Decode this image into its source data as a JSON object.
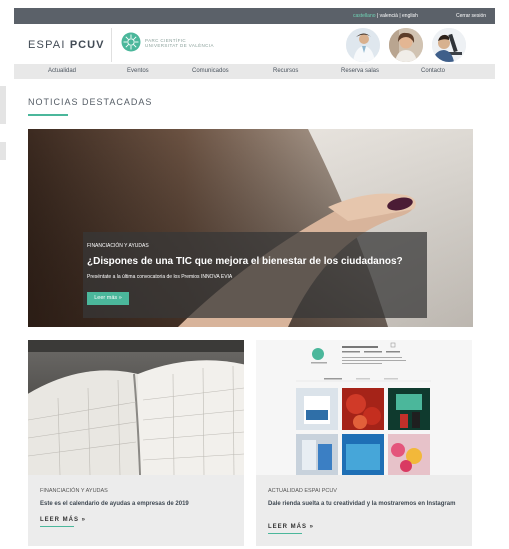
{
  "top_bar": {
    "languages": [
      {
        "label": "castellano",
        "active": true
      },
      {
        "label": "valencià",
        "active": false
      },
      {
        "label": "english",
        "active": false
      }
    ],
    "separator": " | ",
    "logout": "Cerrar sesión"
  },
  "header": {
    "logo_prefix": "ESPAI ",
    "logo_bold": "PCUV",
    "park_line1": "PARC CIENTÍFIC",
    "park_line2": "UNIVERSITAT DE VALÈNCIA"
  },
  "nav": [
    "Actualidad",
    "Eventos",
    "Comunicados",
    "Recursos",
    "Reserva salas",
    "Contacto"
  ],
  "section": {
    "title": "NOTICIAS DESTACADAS"
  },
  "hero": {
    "category": "FINANCIACIÓN Y AYUDAS",
    "title": "¿Dispones de una TIC que mejora el bienestar de los ciudadanos?",
    "subtitle": "Preséntate a la última convocatoria de los Premios INNOVA EVIA",
    "button": "Leer más »"
  },
  "cards": [
    {
      "category": "FINANCIACIÓN Y AYUDAS",
      "title": "Este es el calendario de ayudas a empresas de 2019",
      "more": "LEER MÁS »"
    },
    {
      "category": "ACTUALIDAD ESPAI PCUV",
      "title": "Dale rienda suelta a tu creatividad y la mostraremos en Instagram",
      "more": "LEER MÁS »"
    }
  ],
  "instagram_mock": {
    "handle": "parc.cientific.uvalencia",
    "button": "Seguir"
  },
  "colors": {
    "accent": "#4bb79b",
    "top_bar": "#5b6169",
    "nav_bg": "#e8e8e8",
    "card_bg": "#ececec"
  }
}
